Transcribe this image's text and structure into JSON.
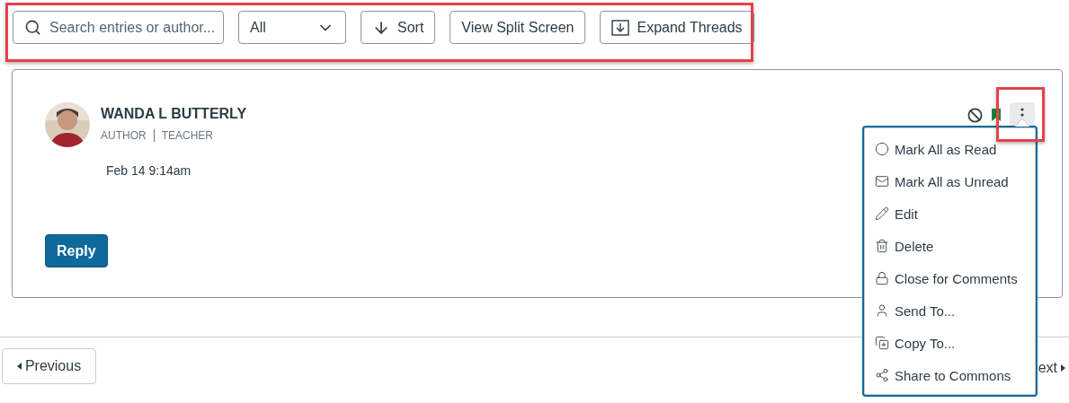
{
  "toolbar": {
    "search": {
      "placeholder": "Search entries or author..."
    },
    "filter": {
      "value": "All"
    },
    "sort": {
      "label": "Sort"
    },
    "split_button": {
      "label": "View Split Screen"
    },
    "expand_button": {
      "label": "Expand Threads"
    }
  },
  "entry": {
    "author": "WANDA L BUTTERLY",
    "roles": [
      "AUTHOR",
      "TEACHER"
    ],
    "date": "Feb 14 9:14am",
    "reply_button": "Reply",
    "menu_open": true
  },
  "menu": [
    {
      "kind": "read",
      "label": "Mark All as Read"
    },
    {
      "kind": "unread",
      "label": "Mark All as Unread"
    },
    {
      "kind": "edit",
      "label": "Edit"
    },
    {
      "kind": "delete",
      "label": "Delete"
    },
    {
      "kind": "lock",
      "label": "Close for Comments"
    },
    {
      "kind": "send",
      "label": "Send To..."
    },
    {
      "kind": "copy",
      "label": "Copy To..."
    },
    {
      "kind": "share",
      "label": "Share to Commons"
    }
  ],
  "pagination": {
    "previous": "Previous",
    "next": "ext"
  }
}
